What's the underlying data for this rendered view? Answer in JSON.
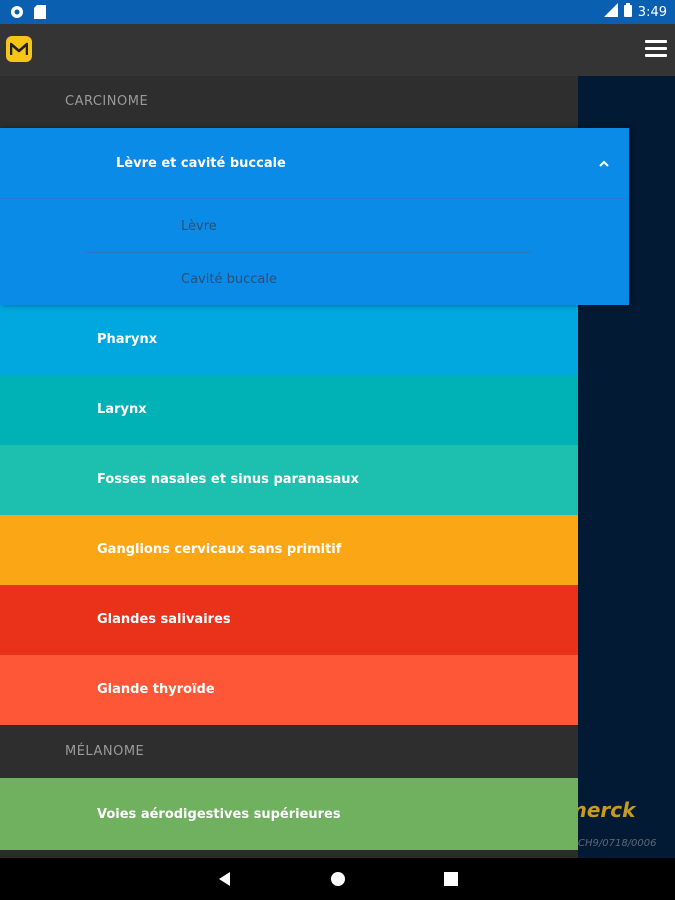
{
  "status_bar": {
    "time": "3:49",
    "icons": [
      "settings-circle-icon",
      "sd-card-icon",
      "signal-icon",
      "battery-icon"
    ]
  },
  "app_bar": {
    "logo_icon": "merck-m-logo-icon",
    "menu_icon": "hamburger-menu-icon"
  },
  "drawer": {
    "sections": [
      {
        "header": "CARCINOME",
        "items": [
          {
            "label": "Lèvre et cavité buccale",
            "expanded": true,
            "color": "#0a8be8",
            "children": [
              "Lèvre",
              "Cavité buccale"
            ]
          },
          {
            "label": "Pharynx",
            "color": "#00a8e0"
          },
          {
            "label": "Larynx",
            "color": "#00b2b6"
          },
          {
            "label": "Fosses nasales et sinus paranasaux",
            "color": "#1dc0ae"
          },
          {
            "label": "Ganglions cervicaux sans primitif",
            "color": "#fba614"
          },
          {
            "label": "Glandes salivaires",
            "color": "#ea321b"
          },
          {
            "label": "Glande thyroïde",
            "color": "#fd5737"
          }
        ]
      },
      {
        "header": "MÉLANOME",
        "items": [
          {
            "label": "Voies aérodigestives supérieures",
            "color": "#6fb15e"
          }
        ]
      }
    ]
  },
  "background": {
    "brand_text": "merck",
    "code_text": "CH9/0718/0006"
  },
  "nav_bar": {
    "icons": [
      "back-icon",
      "home-icon",
      "recents-icon"
    ]
  }
}
